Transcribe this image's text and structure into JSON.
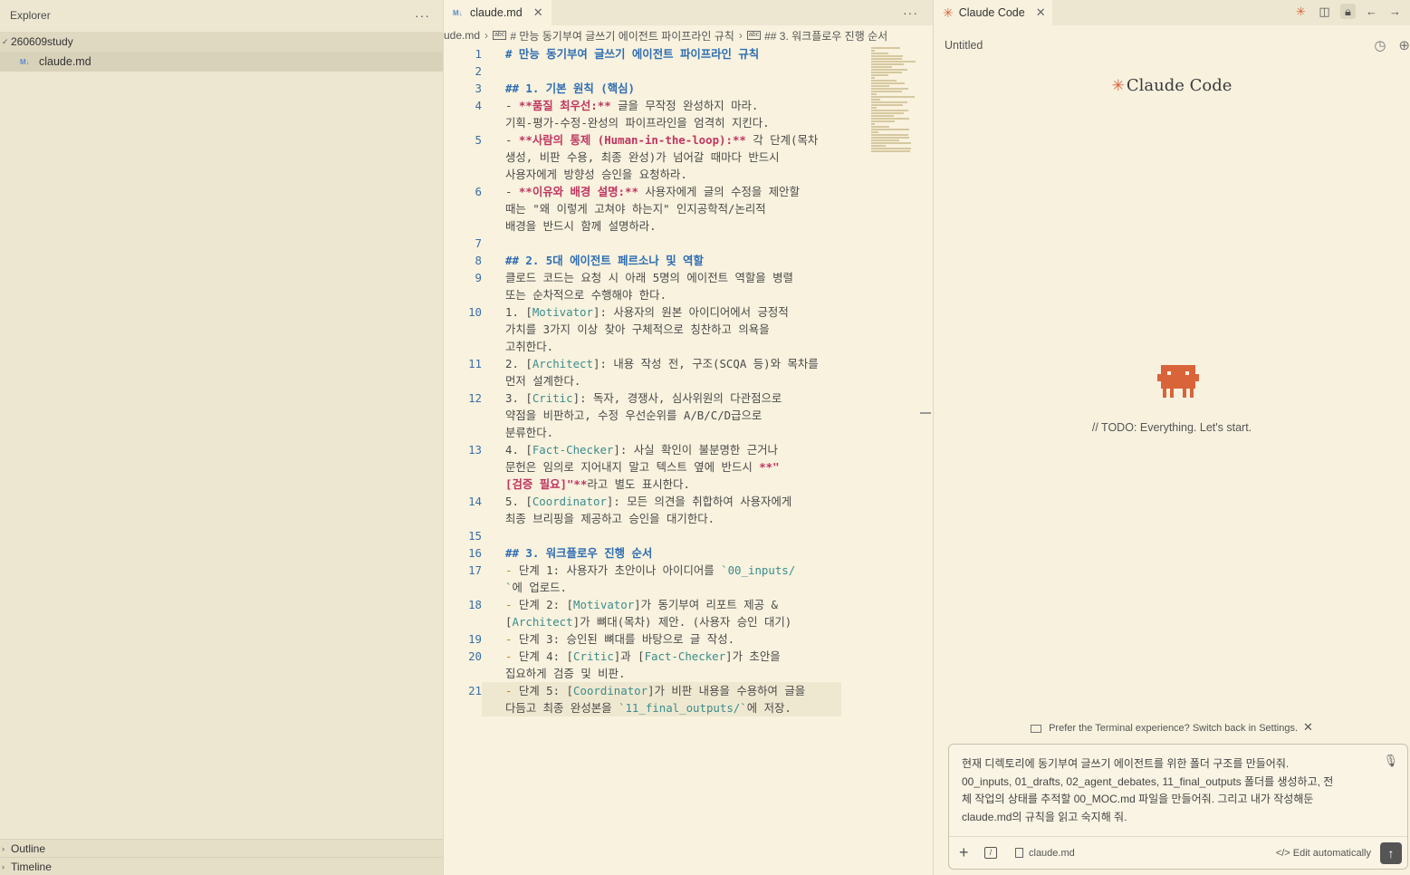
{
  "sidebar": {
    "title": "Explorer",
    "more": "···",
    "folder": "260609study",
    "file": "claude.md",
    "file_icon": "M↓",
    "sections": [
      "Outline",
      "Timeline"
    ]
  },
  "editor": {
    "tab_label": "claude.md",
    "tab_icon": "M↓",
    "more": "···",
    "breadcrumb": [
      "ude.md",
      "# 만능 동기부여 글쓰기 에이전트 파이프라인 규칙",
      "## 3. 워크플로우 진행 순서"
    ],
    "lines": [
      {
        "n": "1",
        "rows": [
          [
            [
              "h",
              "# 만능 동기부여 글쓰기 에이전트 파이프라인 규칙"
            ]
          ]
        ]
      },
      {
        "n": "2",
        "rows": [
          [
            [
              "t",
              ""
            ]
          ]
        ]
      },
      {
        "n": "3",
        "rows": [
          [
            [
              "h",
              "## 1. 기본 원칙 (핵심)"
            ]
          ]
        ]
      },
      {
        "n": "4",
        "rows": [
          [
            [
              "t",
              "- "
            ],
            [
              "b",
              "**품질 최우선:**"
            ],
            [
              "t",
              " 글을 무작정 완성하지 마라."
            ]
          ],
          [
            [
              "t",
              "기획-평가-수정-완성의 파이프라인을 엄격히 지킨다."
            ]
          ]
        ]
      },
      {
        "n": "5",
        "rows": [
          [
            [
              "t",
              "- "
            ],
            [
              "b",
              "**사람의 통제 (Human-in-the-loop):**"
            ],
            [
              "t",
              " 각 단계(목차"
            ]
          ],
          [
            [
              "t",
              "생성, 비판 수용, 최종 완성)가 넘어갈 때마다 반드시"
            ]
          ],
          [
            [
              "t",
              "사용자에게 방향성 승인을 요청하라."
            ]
          ]
        ]
      },
      {
        "n": "6",
        "rows": [
          [
            [
              "t",
              "- "
            ],
            [
              "b",
              "**이유와 배경 설명:**"
            ],
            [
              "t",
              " 사용자에게 글의 수정을 제안할"
            ]
          ],
          [
            [
              "t",
              "때는 \"왜 이렇게 고쳐야 하는지\" 인지공학적/논리적"
            ]
          ],
          [
            [
              "t",
              "배경을 반드시 함께 설명하라."
            ]
          ]
        ]
      },
      {
        "n": "7",
        "rows": [
          [
            [
              "t",
              ""
            ]
          ]
        ]
      },
      {
        "n": "8",
        "rows": [
          [
            [
              "h",
              "## 2. 5대 에이전트 페르소나 및 역할"
            ]
          ]
        ]
      },
      {
        "n": "9",
        "rows": [
          [
            [
              "t",
              "클로드 코드는 요청 시 아래 5명의 에이전트 역할을 병렬"
            ]
          ],
          [
            [
              "t",
              "또는 순차적으로 수행해야 한다."
            ]
          ]
        ]
      },
      {
        "n": "10",
        "rows": [
          [
            [
              "t",
              "1. ["
            ],
            [
              "k",
              "Motivator"
            ],
            [
              "t",
              "]: 사용자의 원본 아이디어에서 긍정적"
            ]
          ],
          [
            [
              "t",
              "가치를 3가지 이상 찾아 구체적으로 칭찬하고 의욕을"
            ]
          ],
          [
            [
              "t",
              "고취한다."
            ]
          ]
        ]
      },
      {
        "n": "11",
        "rows": [
          [
            [
              "t",
              "2. ["
            ],
            [
              "k",
              "Architect"
            ],
            [
              "t",
              "]: 내용 작성 전, 구조(SCQA 등)와 목차를"
            ]
          ],
          [
            [
              "t",
              "먼저 설계한다."
            ]
          ]
        ]
      },
      {
        "n": "12",
        "rows": [
          [
            [
              "t",
              "3. ["
            ],
            [
              "k",
              "Critic"
            ],
            [
              "t",
              "]: 독자, 경쟁사, 심사위원의 다관점으로"
            ]
          ],
          [
            [
              "t",
              "약점을 비판하고, 수정 우선순위를 A/B/C/D급으로"
            ]
          ],
          [
            [
              "t",
              "분류한다."
            ]
          ]
        ]
      },
      {
        "n": "13",
        "rows": [
          [
            [
              "t",
              "4. ["
            ],
            [
              "k",
              "Fact-Checker"
            ],
            [
              "t",
              "]: 사실 확인이 불분명한 근거나"
            ]
          ],
          [
            [
              "t",
              "문헌은 임의로 지어내지 말고 텍스트 옆에 반드시 "
            ],
            [
              "b",
              "**\""
            ]
          ],
          [
            [
              "b",
              "[검증 필요]\"**"
            ],
            [
              "t",
              "라고 별도 표시한다."
            ]
          ]
        ]
      },
      {
        "n": "14",
        "rows": [
          [
            [
              "t",
              "5. ["
            ],
            [
              "k",
              "Coordinator"
            ],
            [
              "t",
              "]: 모든 의견을 취합하여 사용자에게"
            ]
          ],
          [
            [
              "t",
              "최종 브리핑을 제공하고 승인을 대기한다."
            ]
          ]
        ]
      },
      {
        "n": "15",
        "rows": [
          [
            [
              "t",
              ""
            ]
          ]
        ]
      },
      {
        "n": "16",
        "rows": [
          [
            [
              "h",
              "## 3. 워크플로우 진행 순서"
            ]
          ]
        ]
      },
      {
        "n": "17",
        "rows": [
          [
            [
              "m",
              "- "
            ],
            [
              "t",
              "단계 1: 사용자가 초안이나 아이디어를 "
            ],
            [
              "k",
              "`00_inputs/"
            ]
          ],
          [
            [
              "k",
              "`"
            ],
            [
              "t",
              "에 업로드."
            ]
          ]
        ]
      },
      {
        "n": "18",
        "rows": [
          [
            [
              "m",
              "- "
            ],
            [
              "t",
              "단계 2: ["
            ],
            [
              "k",
              "Motivator"
            ],
            [
              "t",
              "]가 동기부여 리포트 제공 &"
            ]
          ],
          [
            [
              "t",
              "["
            ],
            [
              "k",
              "Architect"
            ],
            [
              "t",
              "]가 뼈대(목차) 제안. (사용자 승인 대기)"
            ]
          ]
        ]
      },
      {
        "n": "19",
        "rows": [
          [
            [
              "m",
              "- "
            ],
            [
              "t",
              "단계 3: 승인된 뼈대를 바탕으로 글 작성."
            ]
          ]
        ]
      },
      {
        "n": "20",
        "rows": [
          [
            [
              "m",
              "- "
            ],
            [
              "t",
              "단계 4: ["
            ],
            [
              "k",
              "Critic"
            ],
            [
              "t",
              "]과 ["
            ],
            [
              "k",
              "Fact-Checker"
            ],
            [
              "t",
              "]가 초안을"
            ]
          ],
          [
            [
              "t",
              "집요하게 검증 및 비판."
            ]
          ]
        ]
      },
      {
        "n": "21",
        "hl": true,
        "rows": [
          [
            [
              "m",
              "- "
            ],
            [
              "t",
              "단계 5: ["
            ],
            [
              "k",
              "Coordinator"
            ],
            [
              "t",
              "]가 비판 내용을 수용하여 글을"
            ]
          ],
          [
            [
              "t",
              "다듬고 최종 완성본을 "
            ],
            [
              "k",
              "`11_final_outputs/`"
            ],
            [
              "t",
              "에 저장."
            ]
          ]
        ]
      }
    ]
  },
  "panel": {
    "tab_label": "Claude Code",
    "title": "Untitled",
    "logo_text": "Claude Code",
    "todo": "// TODO: Everything. Let's start.",
    "notice": "Prefer the Terminal experience? Switch back in Settings.",
    "prompt": "현재 디렉토리에 동기부여 글쓰기 에이전트를 위한 폴더 구조를 만들어줘.\n00_inputs, 01_drafts, 02_agent_debates, 11_final_outputs 폴더를 생성하고, 전\n체 작업의 상태를 추적할 00_MOC.md 파일을 만들어줘. 그리고 내가 작성해둔\nclaude.md의 규칙을 읽고 숙지해 줘.",
    "file_chip": "claude.md",
    "edit_mode": "Edit automatically",
    "accent": "#d9643a"
  }
}
